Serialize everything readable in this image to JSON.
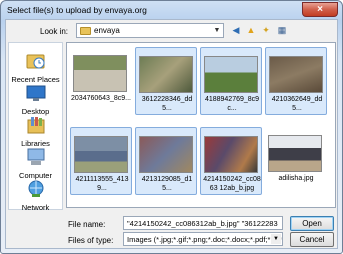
{
  "window": {
    "title": "Select file(s) to upload by envaya.org",
    "close_glyph": "×"
  },
  "lookin": {
    "label": "Look in:",
    "value": "envaya"
  },
  "toolbar": {
    "back_glyph": "◀",
    "up_glyph": "▲",
    "newfolder_glyph": "✦",
    "views_glyph": "▦"
  },
  "places": [
    {
      "label": "Recent Places",
      "icon": "recent-places-icon"
    },
    {
      "label": "Desktop",
      "icon": "desktop-icon"
    },
    {
      "label": "Libraries",
      "icon": "libraries-icon"
    },
    {
      "label": "Computer",
      "icon": "computer-icon"
    },
    {
      "label": "Network",
      "icon": "network-icon"
    }
  ],
  "files": [
    {
      "name": "2034760643_8c9...",
      "selected": false
    },
    {
      "name": "3612228346_dd5...",
      "selected": true
    },
    {
      "name": "4188942769_8c9c...",
      "selected": true
    },
    {
      "name": "4210362649_dd5...",
      "selected": true
    },
    {
      "name": "4211113555_4139...",
      "selected": true
    },
    {
      "name": "4213129085_d15...",
      "selected": true
    },
    {
      "name": "4214150242_cc0863 12ab_b.jpg",
      "selected": true
    },
    {
      "name": "adilisha.jpg",
      "selected": false
    }
  ],
  "filename": {
    "label": "File name:",
    "value": "\"4214150242_cc086312ab_b.jpg\" \"36122283"
  },
  "filetype": {
    "label": "Files of type:",
    "value": "Images (*.jpg;*.gif;*.png;*.doc;*.docx;*.pdf;*.rtf;*"
  },
  "buttons": {
    "open": "Open",
    "cancel": "Cancel"
  }
}
